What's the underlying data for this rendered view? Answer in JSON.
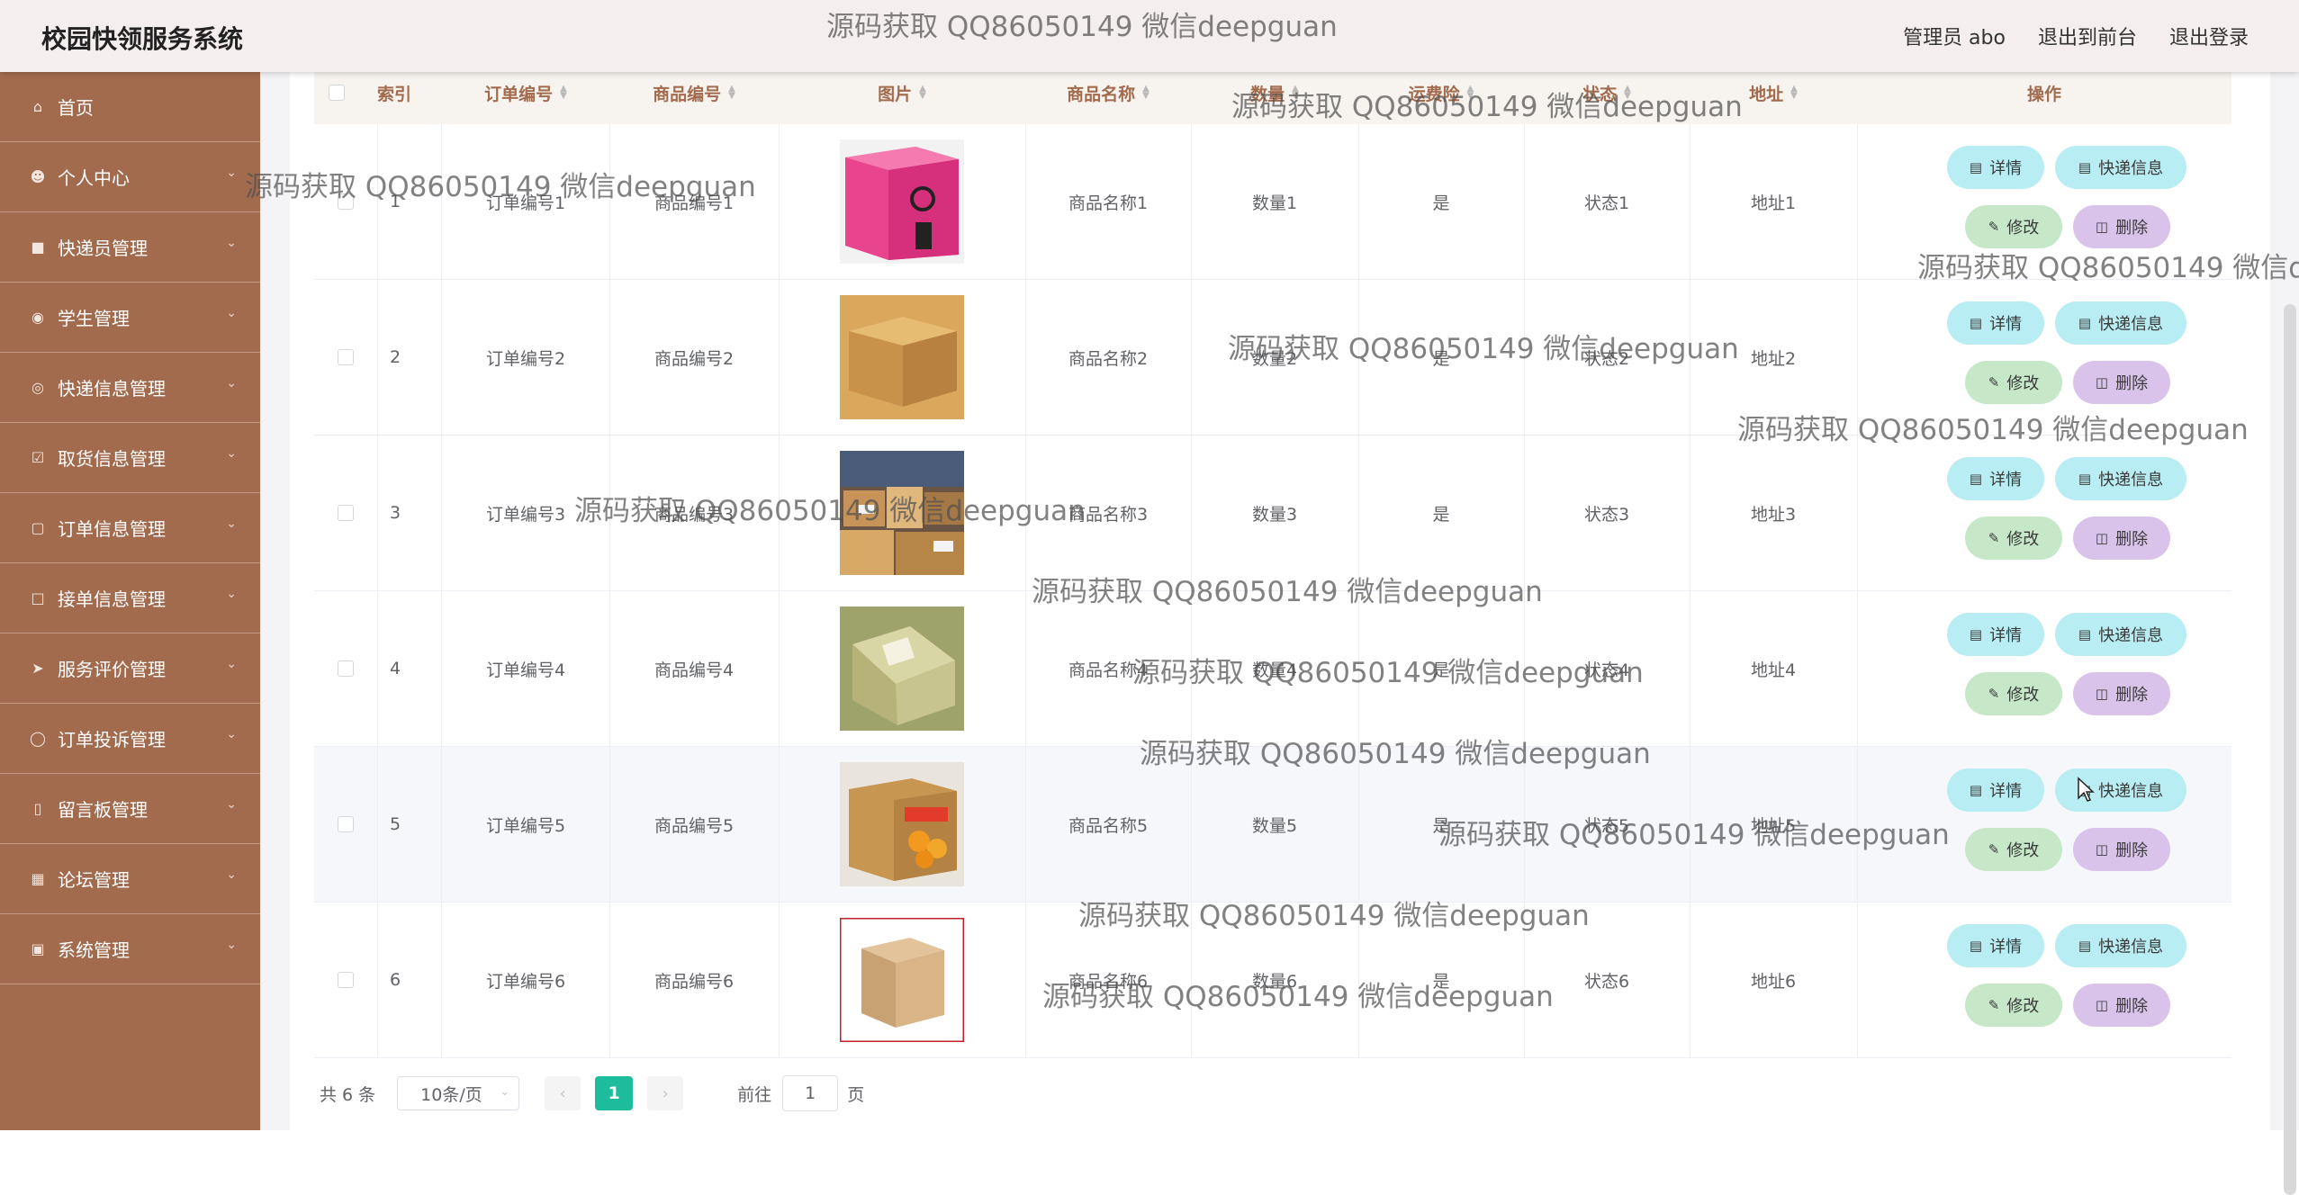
{
  "header": {
    "title": "校园快领服务系统",
    "user": "管理员 abo",
    "to_front": "退出到前台",
    "logout": "退出登录"
  },
  "sidebar": {
    "items": [
      {
        "label": "首页",
        "icon": "home-icon",
        "has_chevron": false
      },
      {
        "label": "个人中心",
        "icon": "user-icon",
        "has_chevron": true
      },
      {
        "label": "快递员管理",
        "icon": "courier-icon",
        "has_chevron": true
      },
      {
        "label": "学生管理",
        "icon": "student-icon",
        "has_chevron": true
      },
      {
        "label": "快递信息管理",
        "icon": "compass-icon",
        "has_chevron": true
      },
      {
        "label": "取货信息管理",
        "icon": "checklist-icon",
        "has_chevron": true
      },
      {
        "label": "订单信息管理",
        "icon": "briefcase-icon",
        "has_chevron": true
      },
      {
        "label": "接单信息管理",
        "icon": "chat-icon",
        "has_chevron": true
      },
      {
        "label": "服务评价管理",
        "icon": "send-icon",
        "has_chevron": true
      },
      {
        "label": "订单投诉管理",
        "icon": "globe-icon",
        "has_chevron": true
      },
      {
        "label": "留言板管理",
        "icon": "phone-icon",
        "has_chevron": true
      },
      {
        "label": "论坛管理",
        "icon": "chart-icon",
        "has_chevron": true
      },
      {
        "label": "系统管理",
        "icon": "monitor-icon",
        "has_chevron": true
      }
    ]
  },
  "table": {
    "columns": [
      "索引",
      "订单编号",
      "商品编号",
      "图片",
      "商品名称",
      "数量",
      "运费险",
      "状态",
      "地址",
      "操作"
    ],
    "rows": [
      {
        "index": "1",
        "order_no": "订单编号1",
        "goods_no": "商品编号1",
        "goods_name": "商品名称1",
        "qty": "数量1",
        "insurance": "是",
        "status": "状态1",
        "address": "地址1",
        "image": "pink-box"
      },
      {
        "index": "2",
        "order_no": "订单编号2",
        "goods_no": "商品编号2",
        "goods_name": "商品名称2",
        "qty": "数量2",
        "insurance": "是",
        "status": "状态2",
        "address": "地址2",
        "image": "kraft-box"
      },
      {
        "index": "3",
        "order_no": "订单编号3",
        "goods_no": "商品编号3",
        "goods_name": "商品名称3",
        "qty": "数量3",
        "insurance": "是",
        "status": "状态3",
        "address": "地址3",
        "image": "parcel-pile"
      },
      {
        "index": "4",
        "order_no": "订单编号4",
        "goods_no": "商品编号4",
        "goods_name": "商品名称4",
        "qty": "数量4",
        "insurance": "是",
        "status": "状态4",
        "address": "地址4",
        "image": "taped-box"
      },
      {
        "index": "5",
        "order_no": "订单编号5",
        "goods_no": "商品编号5",
        "goods_name": "商品名称5",
        "qty": "数量5",
        "insurance": "是",
        "status": "状态5",
        "address": "地址5",
        "image": "fruit-box"
      },
      {
        "index": "6",
        "order_no": "订单编号6",
        "goods_no": "商品编号6",
        "goods_name": "商品名称6",
        "qty": "数量6",
        "insurance": "是",
        "status": "状态6",
        "address": "地址6",
        "image": "carton-box"
      }
    ],
    "actions": {
      "detail": "详情",
      "express": "快递信息",
      "edit": "修改",
      "delete": "删除"
    }
  },
  "pagination": {
    "total": "共 6 条",
    "page_size": "10条/页",
    "current": "1",
    "goto_label": "前往",
    "goto_value": "1",
    "page_unit": "页"
  },
  "watermark": "源码获取 QQ86050149 微信deepguan",
  "colors": {
    "sidebar": "#a26b4e",
    "header": "#f4efee",
    "accent": "#1cbc9c",
    "btn_info": "#b7edf3",
    "btn_edit": "#c6e8c8",
    "btn_delete": "#d9c3ea"
  }
}
